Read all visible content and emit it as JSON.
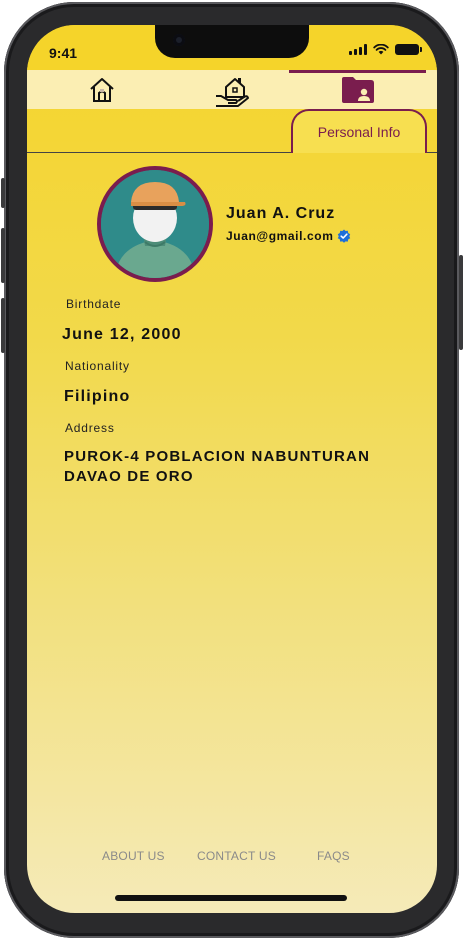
{
  "status_bar": {
    "time": "9:41"
  },
  "nav": {
    "items": [
      {
        "icon": "home-icon"
      },
      {
        "icon": "housing-assistance-icon"
      },
      {
        "icon": "profile-folder-icon",
        "active": true
      }
    ]
  },
  "tabs": {
    "active_label": "Personal Info"
  },
  "profile": {
    "name": "Juan A. Cruz",
    "email": "Juan@gmail.com",
    "verified_icon": "verified-check-icon"
  },
  "fields": {
    "birthdate_label": "Birthdate",
    "birthdate_value": "June 12, 2000",
    "nationality_label": "Nationality",
    "nationality_value": "Filipino",
    "address_label": "Address",
    "address_value": "PUROK-4 POBLACION NABUNTURAN DAVAO DE ORO"
  },
  "footer": {
    "about": "ABOUT US",
    "contact": "CONTACT US",
    "faqs": "FAQS"
  },
  "colors": {
    "accent": "#7a1d4e",
    "background_top": "#f5d42b",
    "background_bottom": "#f5eab8",
    "nav_bg": "#fbeeb3",
    "verified": "#1f6fd8"
  }
}
